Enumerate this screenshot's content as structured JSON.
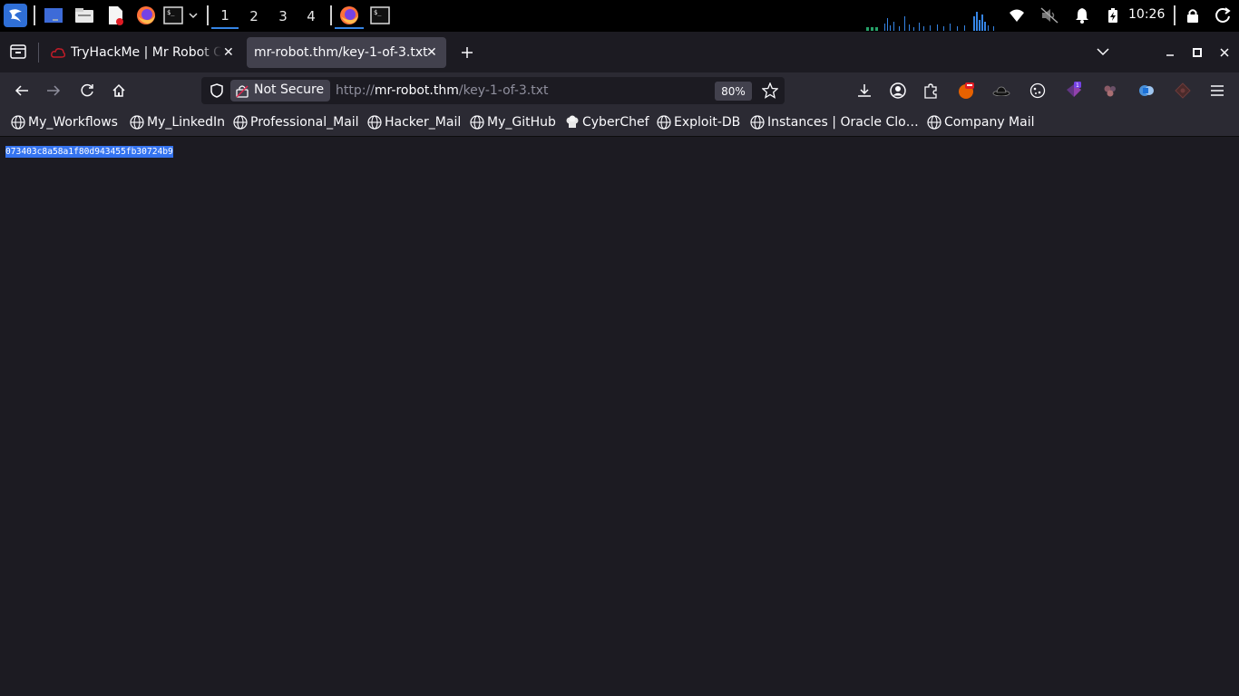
{
  "taskbar": {
    "workspaces": [
      "1",
      "2",
      "3",
      "4"
    ],
    "active_workspace": "1",
    "clock": "10:26"
  },
  "tabs": [
    {
      "title": "TryHackMe | Mr Robot CTF",
      "active": false
    },
    {
      "title": "mr-robot.thm/key-1-of-3.txt",
      "active": true
    }
  ],
  "navbar": {
    "security_label": "Not Secure",
    "url_scheme": "http://",
    "url_host": "mr-robot.thm",
    "url_path": "/key-1-of-3.txt",
    "zoom": "80%"
  },
  "bookmarks": [
    {
      "label": "My_Workflows",
      "icon": "globe-icon"
    },
    {
      "label": "My_LinkedIn",
      "icon": "globe-icon"
    },
    {
      "label": "Professional_Mail",
      "icon": "globe-icon"
    },
    {
      "label": "Hacker_Mail",
      "icon": "globe-icon"
    },
    {
      "label": "My_GitHub",
      "icon": "globe-icon"
    },
    {
      "label": "CyberChef",
      "icon": "chef-icon"
    },
    {
      "label": "Exploit-DB",
      "icon": "globe-icon"
    },
    {
      "label": "Instances | Oracle Clo…",
      "icon": "globe-icon"
    },
    {
      "label": "Company Mail",
      "icon": "globe-icon"
    }
  ],
  "content": {
    "text": "073403c8a58a1f80d943455fb30724b9"
  },
  "colors": {
    "accent": "#3584e4",
    "selection": "#3574f0",
    "toolbar_bg": "#2b2a33",
    "page_bg": "#1c1b22"
  }
}
